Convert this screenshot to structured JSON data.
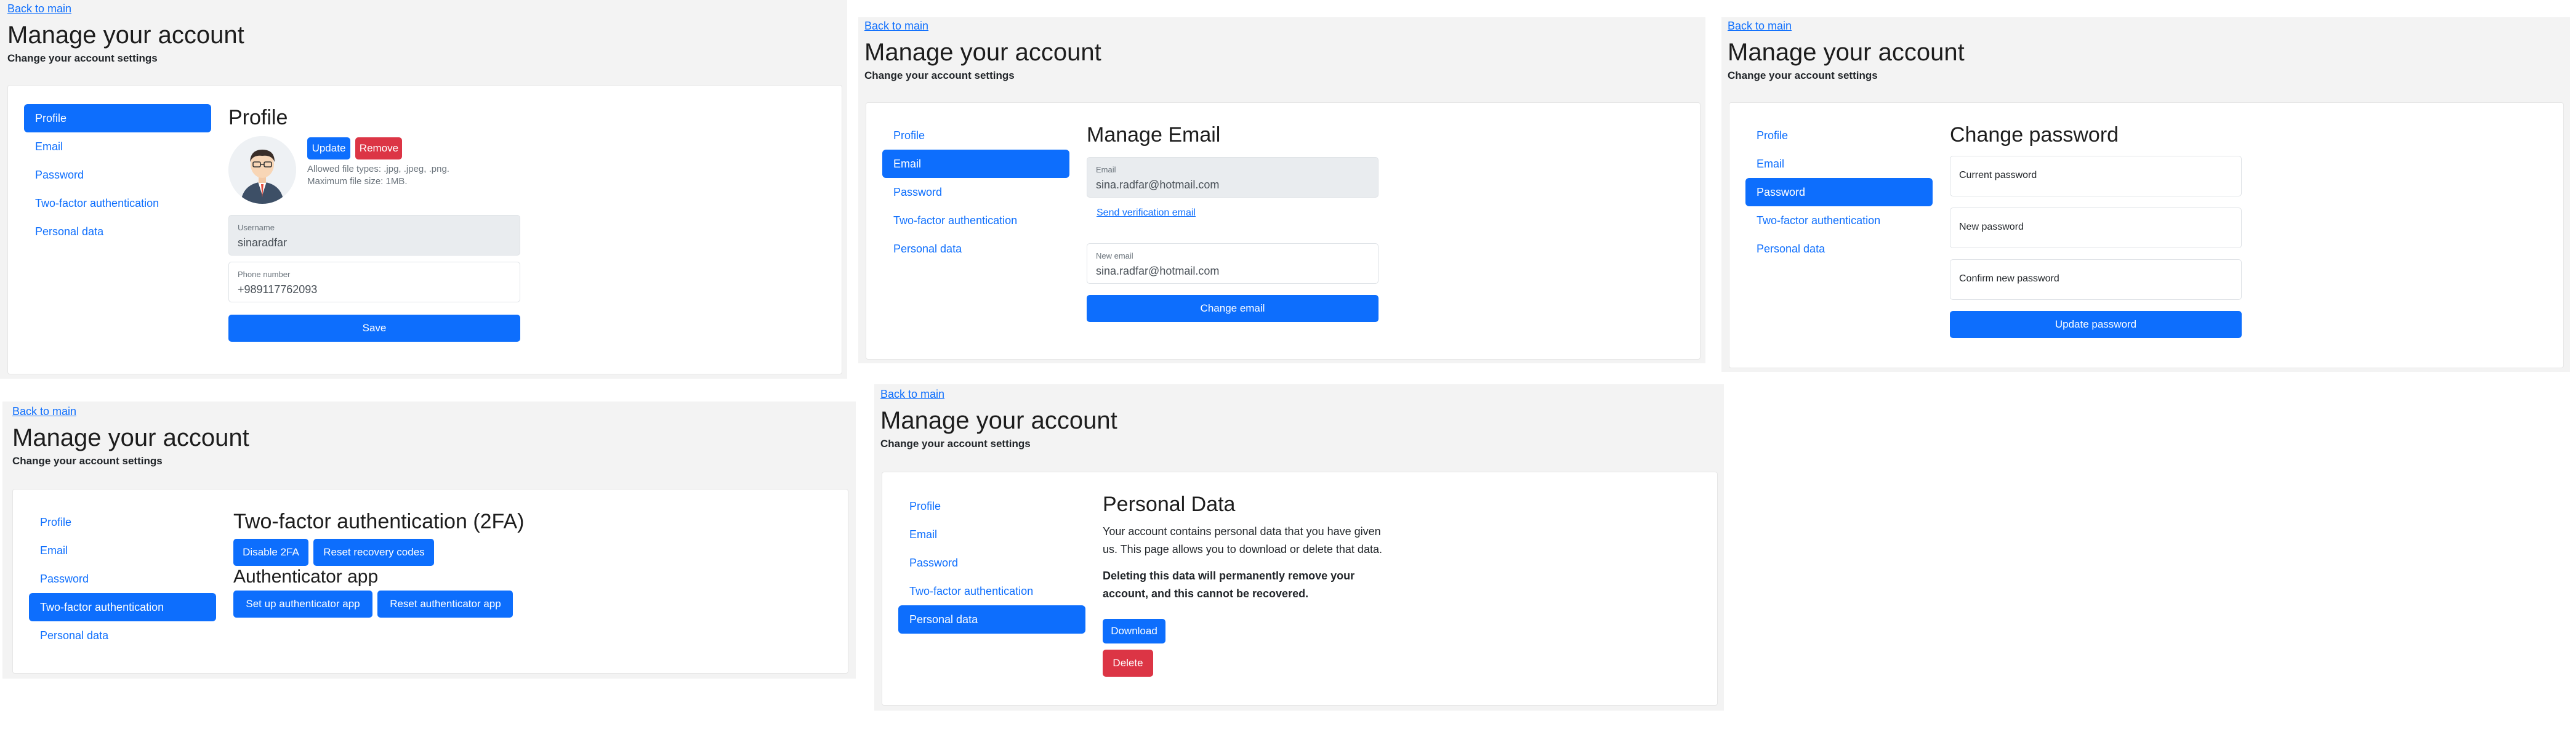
{
  "common": {
    "back_link": "Back to main",
    "title": "Manage your account",
    "subtitle": "Change your account settings",
    "nav": [
      "Profile",
      "Email",
      "Password",
      "Two-factor authentication",
      "Personal data"
    ]
  },
  "profile": {
    "heading": "Profile",
    "update_btn": "Update",
    "remove_btn": "Remove",
    "file_note_1": "Allowed file types: .jpg, .jpeg, .png.",
    "file_note_2": "Maximum file size: 1MB.",
    "username_label": "Username",
    "username_value": "sinaradfar",
    "phone_label": "Phone number",
    "phone_value": "+989117762093",
    "save_btn": "Save"
  },
  "email": {
    "heading": "Manage Email",
    "email_label": "Email",
    "email_value": "sina.radfar@hotmail.com",
    "verify_link": "Send verification email",
    "new_email_label": "New email",
    "new_email_value": "sina.radfar@hotmail.com",
    "change_btn": "Change email"
  },
  "password": {
    "heading": "Change password",
    "current_placeholder": "Current password",
    "new_placeholder": "New password",
    "confirm_placeholder": "Confirm new password",
    "update_btn": "Update password"
  },
  "twofa": {
    "heading": "Two-factor authentication (2FA)",
    "disable_btn": "Disable 2FA",
    "reset_codes_btn": "Reset recovery codes",
    "auth_heading": "Authenticator app",
    "setup_btn": "Set up authenticator app",
    "reset_app_btn": "Reset authenticator app"
  },
  "personal": {
    "heading": "Personal Data",
    "para_line1": "Your account contains personal data that you have given",
    "para_line2": "us. This page allows you to download or delete that data.",
    "warn_line1": "Deleting this data will permanently remove your",
    "warn_line2": "account, and this cannot be recovered.",
    "download_btn": "Download",
    "delete_btn": "Delete"
  },
  "colors": {
    "primary": "#0d6efd",
    "danger": "#dc3545",
    "panel_bg": "#f3f3f3"
  }
}
